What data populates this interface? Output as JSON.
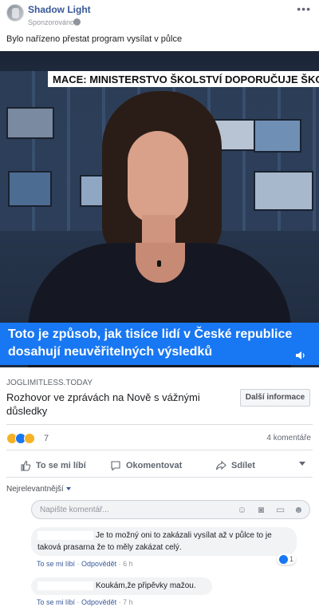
{
  "post": {
    "author": "Shadow Light",
    "sponsored_label": "Sponzorováno",
    "text": "Bylo nařízeno přestat program vysílat v půlce"
  },
  "media": {
    "ticker": "MACE: MINISTERSTVO ŠKOLSTVÍ DOPORUČUJE ŠKOLÁM",
    "caption_line1": "Toto je způsob, jak tisíce lidí v České republice",
    "caption_line2": "dosahují neuvěřitelných výsledků",
    "caption_color": "#1877f2"
  },
  "link": {
    "domain": "JOGLIMITLESS.TODAY",
    "title": "Rozhovor ve zprávách na Nově s vážnými důsledky",
    "button_label": "Další informace"
  },
  "stats": {
    "reaction_count": "7",
    "comment_count": "4 komentáře",
    "reactions": [
      "haha",
      "like",
      "sad"
    ]
  },
  "actions": {
    "like": "To se mi líbí",
    "comment": "Okomentovat",
    "share": "Sdílet"
  },
  "comments_section": {
    "sort_label": "Nejrelevantnější",
    "input_placeholder": "Napište komentář...",
    "comments": [
      {
        "text_line1": "Je to možný oni to zakázali vysílat až v půlce to je",
        "text_line2": "taková prasarna že to měly zakázat celý.",
        "like_label": "To se mi líbí",
        "reply_label": "Odpovědět",
        "time": "6 h",
        "reaction_count": "1"
      },
      {
        "text_line1": "Koukám,že připěvky mažou.",
        "like_label": "To se mi líbí",
        "reply_label": "Odpovědět",
        "time": "7 h"
      }
    ]
  }
}
